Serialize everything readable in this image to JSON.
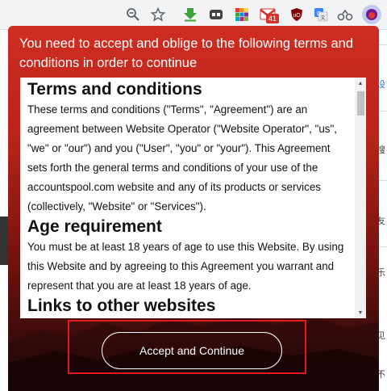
{
  "toolbar": {
    "icons": [
      "zoom-out-icon",
      "star-icon",
      "download-extension-icon",
      "tab-extension-icon",
      "color-grid-extension-icon",
      "gmail-extension-icon",
      "ublock-icon",
      "translate-icon",
      "extensions-icon",
      "profile-avatar-icon"
    ],
    "mail_badge": "41"
  },
  "background_page": {
    "right_fragments": [
      "设",
      "搜",
      "友",
      "乐",
      "见",
      "不"
    ]
  },
  "modal": {
    "header": "You need to accept and oblige to the following terms and conditions in order to continue",
    "sections": [
      {
        "heading": "Terms and conditions",
        "body": "These terms and conditions (\"Terms\", \"Agreement\") are an agreement between Website Operator (\"Website Operator\", \"us\", \"we\" or \"our\") and you (\"User\", \"you\" or \"your\"). This Agreement sets forth the general terms and conditions of your use of the accountspool.com website and any of its products or services (collectively, \"Website\" or \"Services\")."
      },
      {
        "heading": "Age requirement",
        "body": "You must be at least 18 years of age to use this Website. By using this Website and by agreeing to this Agreement you warrant and represent that you are at least 18 years of age."
      },
      {
        "heading": "Links to other websites",
        "body": ""
      }
    ],
    "accept_label": "Accept and Continue"
  },
  "colors": {
    "modal_red": "#cf2d22",
    "highlight": "#e01b1b"
  }
}
